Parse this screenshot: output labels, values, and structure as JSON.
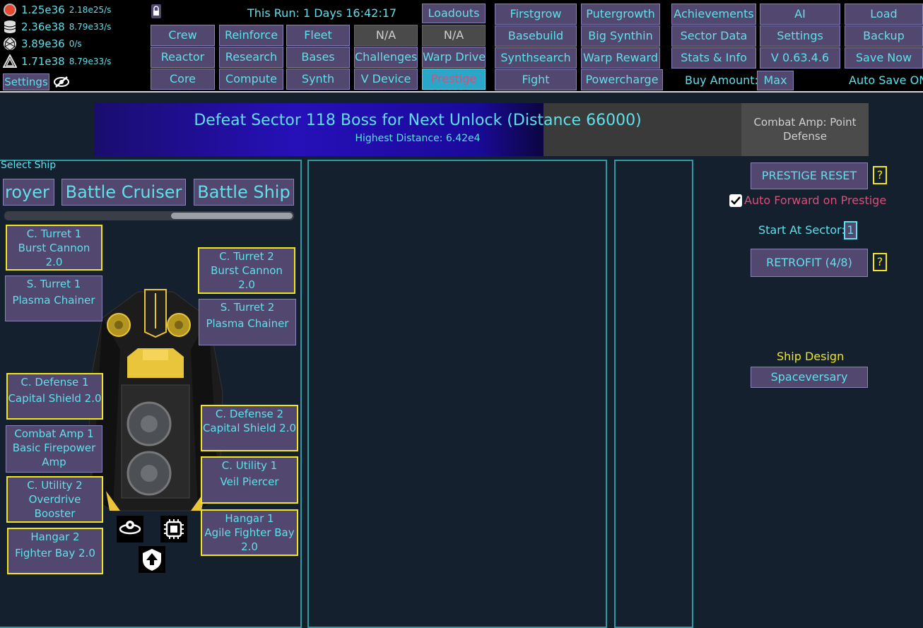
{
  "resources": [
    {
      "icon": "red-circle-icon",
      "value": "1.25e36",
      "rate": "2.18e25/s"
    },
    {
      "icon": "database-icon",
      "value": "2.36e38",
      "rate": "8.79e33/s"
    },
    {
      "icon": "geodesic-sphere-icon",
      "value": "3.89e36",
      "rate": "0/s"
    },
    {
      "icon": "triangle-icon",
      "value": "1.71e38",
      "rate": "8.79e33/s"
    }
  ],
  "top": {
    "settings_label": "Settings",
    "run_time": "This Run: 1 Days 16:42:17",
    "buy_amount_label": "Buy Amount:",
    "buy_amount_value": "Max",
    "auto_save": "Auto Save ON"
  },
  "nav": {
    "crew": "Crew",
    "reinforce": "Reinforce",
    "fleet": "Fleet",
    "na1": "N/A",
    "na2": "N/A",
    "reactor": "Reactor",
    "research": "Research",
    "bases": "Bases",
    "challenges": "Challenges",
    "warp_drive": "Warp Drive",
    "core": "Core",
    "compute": "Compute",
    "synth": "Synth",
    "v_device": "V Device",
    "prestige": "Prestige",
    "loadouts": "Loadouts",
    "firstgrow": "Firstgrow",
    "putergrowth": "Putergrowth",
    "achievements": "Achievements",
    "ai": "AI",
    "load": "Load",
    "basebuild": "Basebuild",
    "big_synthin": "Big Synthin",
    "sector_data": "Sector Data",
    "settings": "Settings",
    "backup": "Backup",
    "synthsearch": "Synthsearch",
    "warp_reward": "Warp Reward",
    "stats_info": "Stats & Info",
    "version": "V 0.63.4.6",
    "save_now": "Save Now",
    "fight": "Fight",
    "powercharge": "Powercharge"
  },
  "banner": {
    "title": "Defeat Sector 118 Boss for Next Unlock (Distance 66000)",
    "subtitle": "Highest Distance: 6.42e4",
    "progress": 0.694,
    "combat_amp_line1": "Combat Amp: Point",
    "combat_amp_line2": "Defense"
  },
  "ship_select": {
    "label": "Select Ship",
    "ships": [
      "royer",
      "Battle Cruiser",
      "Battle Ship"
    ]
  },
  "slots": {
    "c_turret_1": {
      "name": "C. Turret 1",
      "item": "Burst Cannon",
      "item2": "2.0"
    },
    "c_turret_2": {
      "name": "C. Turret 2",
      "item": "Burst Cannon",
      "item2": "2.0"
    },
    "s_turret_1": {
      "name": "S. Turret 1",
      "item": "Plasma Chainer"
    },
    "s_turret_2": {
      "name": "S. Turret 2",
      "item": "Plasma Chainer"
    },
    "c_defense_1": {
      "name": "C. Defense 1",
      "item": "Capital Shield 2.0"
    },
    "c_defense_2": {
      "name": "C. Defense 2",
      "item": "Capital Shield 2.0"
    },
    "combat_amp_1": {
      "name": "Combat Amp 1",
      "item": "Basic Firepower",
      "item2": "Amp"
    },
    "c_utility_1": {
      "name": "C. Utility 1",
      "item": "Veil Piercer"
    },
    "c_utility_2": {
      "name": "C. Utility 2",
      "item": "Overdrive",
      "item2": "Booster"
    },
    "hangar_1": {
      "name": "Hangar 1",
      "item": "Agile Fighter Bay",
      "item2": "2.0"
    },
    "hangar_2": {
      "name": "Hangar 2",
      "item": "Fighter Bay 2.0"
    }
  },
  "right": {
    "prestige_reset": "PRESTIGE RESET",
    "help": "?",
    "auto_forward": "Auto Forward on Prestige",
    "start_at_label": "Start At Sector:",
    "start_at_value": "1",
    "retrofit": "RETROFIT (4/8)",
    "ship_design_label": "Ship Design",
    "ship_design_value": "Spaceversary"
  },
  "colors": {
    "accent": "#5fe0ea",
    "button": "#52476f",
    "highlight": "#f1e619",
    "warning": "#d84f7a",
    "prestige_active": "#2aa6c8"
  }
}
